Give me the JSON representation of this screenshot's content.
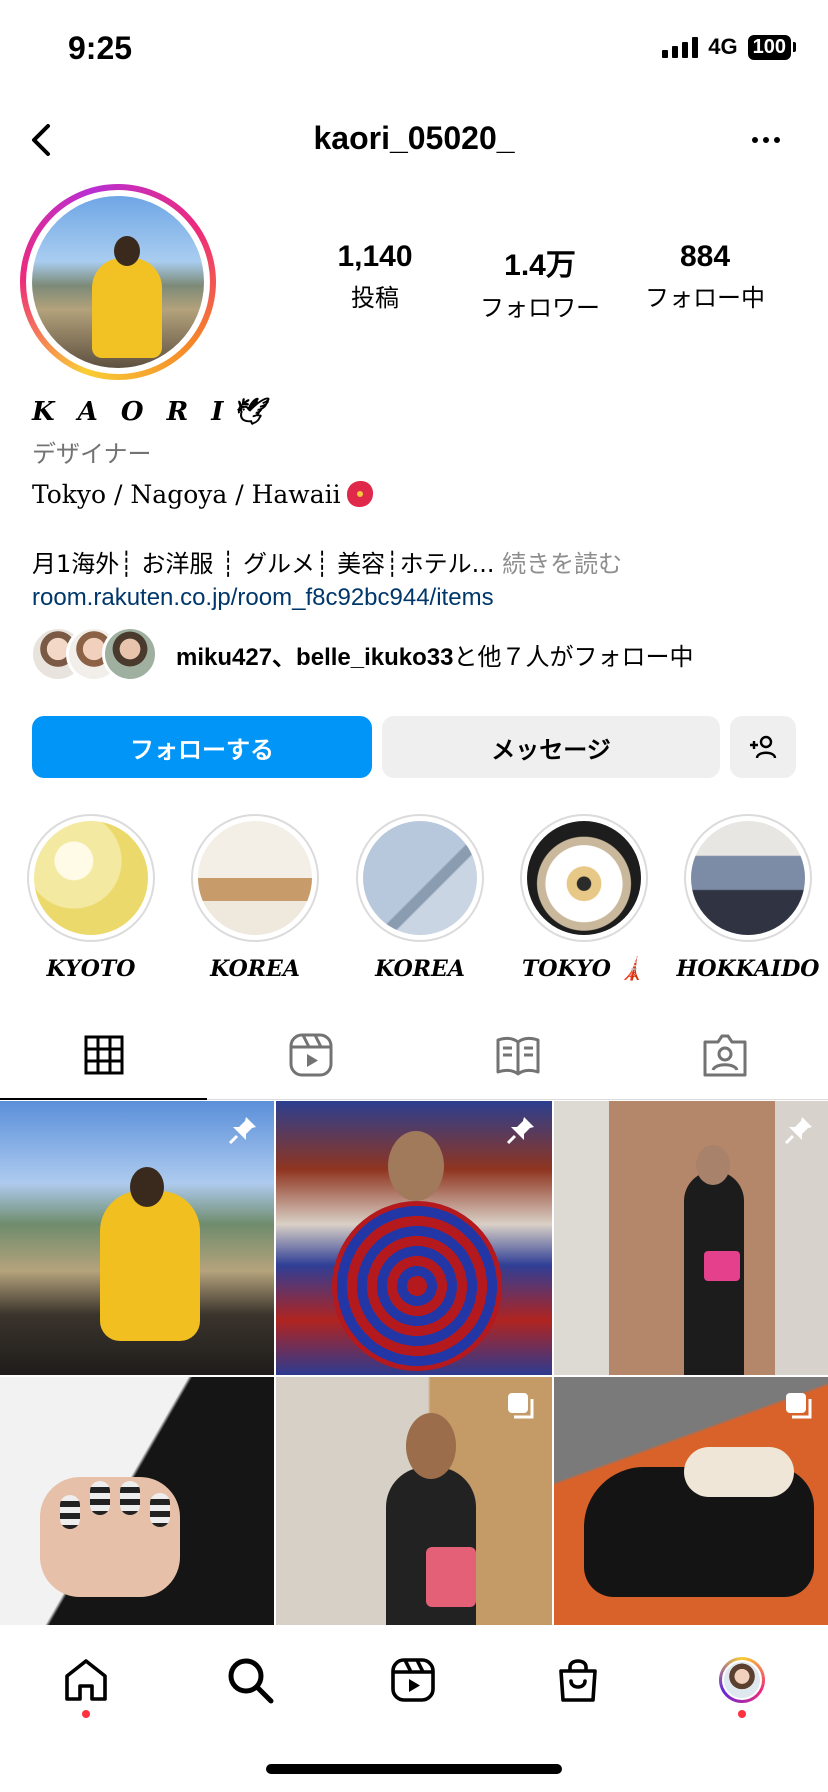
{
  "status_bar": {
    "time": "9:25",
    "network": "4G",
    "battery": "100"
  },
  "header": {
    "username": "kaori_05020_"
  },
  "profile": {
    "stats": [
      {
        "value": "1,140",
        "label": "投稿"
      },
      {
        "value": "1.4万",
        "label": "フォロワー"
      },
      {
        "value": "884",
        "label": "フォロー中"
      }
    ],
    "display_name": "K A O R I",
    "category": "デザイナー",
    "location": "Tokyo / Nagoya / Hawaii",
    "bio": "月1海外┊ お洋服 ┊ グルメ┊ 美容┊ホテル...",
    "bio_more": "続きを読む",
    "link": "room.rakuten.co.jp/room_f8c92bc944/items",
    "followed_by": {
      "names": "miku427、belle_ikuko33",
      "suffix": "と他７人がフォロー中"
    }
  },
  "actions": {
    "follow": "フォローする",
    "message": "メッセージ"
  },
  "highlights": [
    {
      "label": "KYOTO"
    },
    {
      "label": "KOREA"
    },
    {
      "label": "KOREA"
    },
    {
      "label": "TOKYO 🗼"
    },
    {
      "label": "HOKKAIDO"
    }
  ],
  "tabs": [
    "grid-icon",
    "reels-icon",
    "guides-icon",
    "tagged-icon"
  ],
  "colors": {
    "accent": "#0095f6",
    "link": "#00376b",
    "notification_dot": "#ff3040",
    "secondary_text": "#737373"
  }
}
